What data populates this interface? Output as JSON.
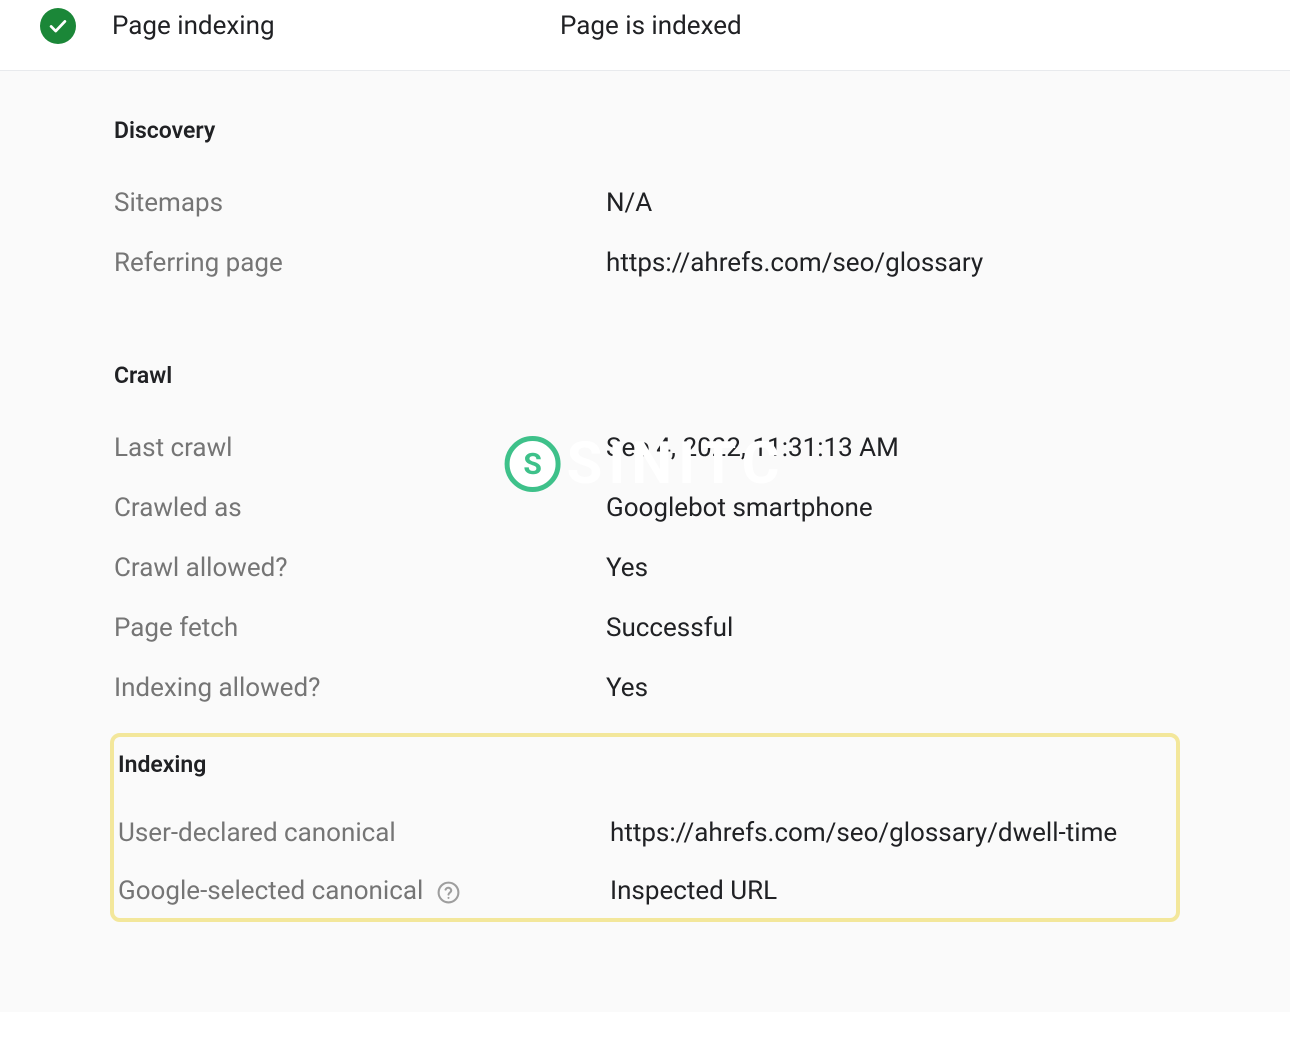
{
  "header": {
    "title": "Page indexing",
    "status": "Page is indexed"
  },
  "discovery": {
    "heading": "Discovery",
    "sitemaps_label": "Sitemaps",
    "sitemaps_value": "N/A",
    "referring_label": "Referring page",
    "referring_value": "https://ahrefs.com/seo/glossary"
  },
  "crawl": {
    "heading": "Crawl",
    "last_crawl_label": "Last crawl",
    "last_crawl_value": "Sep 4, 2022, 11:31:13 AM",
    "crawled_as_label": "Crawled as",
    "crawled_as_value": "Googlebot smartphone",
    "crawl_allowed_label": "Crawl allowed?",
    "crawl_allowed_value": "Yes",
    "page_fetch_label": "Page fetch",
    "page_fetch_value": "Successful",
    "indexing_allowed_label": "Indexing allowed?",
    "indexing_allowed_value": "Yes"
  },
  "indexing": {
    "heading": "Indexing",
    "user_canonical_label": "User-declared canonical",
    "user_canonical_value": "https://ahrefs.com/seo/glossary/dwell-time",
    "google_canonical_label": "Google-selected canonical",
    "google_canonical_value": "Inspected URL"
  },
  "watermark": {
    "badge": "S",
    "text": "SINITC"
  }
}
